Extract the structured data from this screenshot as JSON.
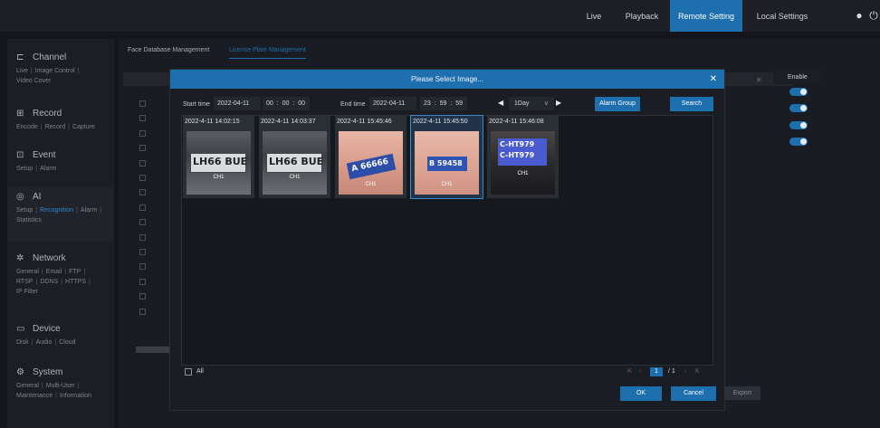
{
  "topnav": {
    "live": "Live",
    "playback": "Playback",
    "remote_setting": "Remote Setting",
    "local_settings": "Local Settings"
  },
  "sidebar": {
    "channel": {
      "title": "Channel",
      "links1": [
        "Live",
        "Image Control"
      ],
      "links2": [
        "Video Cover"
      ]
    },
    "record": {
      "title": "Record",
      "links1": [
        "Encode",
        "Record",
        "Capture"
      ]
    },
    "event": {
      "title": "Event",
      "links1": [
        "Setup",
        "Alarm"
      ]
    },
    "ai": {
      "title": "AI",
      "links1": [
        "Setup",
        "Recognition",
        "Alarm"
      ],
      "links2": [
        "Statistics"
      ]
    },
    "network": {
      "title": "Network",
      "links1": [
        "General",
        "Email",
        "FTP"
      ],
      "links2": [
        "RTSP",
        "DDNS",
        "HTTPS"
      ],
      "links3": [
        "IP Filter"
      ]
    },
    "device": {
      "title": "Device",
      "links1": [
        "Disk",
        "Audio",
        "Cloud"
      ]
    },
    "system": {
      "title": "System",
      "links1": [
        "General",
        "Multi-User"
      ],
      "links2": [
        "Maintenance",
        "Information"
      ]
    }
  },
  "tabs": {
    "face_db": "Face Database Management",
    "plate": "License Plate Management"
  },
  "table": {
    "enable_header": "Enable",
    "export": "Export"
  },
  "dialog": {
    "title": "Please Select Image...",
    "start_label": "Start time",
    "start_date": "2022-04-11",
    "start_time": "00 : 00 : 00",
    "end_label": "End time",
    "end_date": "2022-04-11",
    "end_time": "23 : 59 : 59",
    "range": "1Day",
    "alarm_group": "Alarm Group",
    "search": "Search",
    "all": "All",
    "page_current": "1",
    "page_total": "/ 1",
    "ok": "OK",
    "cancel": "Cancel",
    "images": [
      {
        "time": "2022-4-11 14:02:15",
        "plate": "LH66 BUE",
        "channel": "CH1"
      },
      {
        "time": "2022-4-11 14:03:37",
        "plate": "LH66 BUE",
        "channel": "CH1"
      },
      {
        "time": "2022-4-11 15:45:46",
        "plate": "A 66666",
        "channel": "CH1"
      },
      {
        "time": "2022-4-11 15:45:50",
        "plate": "B 59458",
        "channel": "CH1"
      },
      {
        "time": "2022-4-11 15:46:08",
        "plate": "C-HT979",
        "plate2": "C-HT979",
        "channel": "CH1"
      }
    ]
  },
  "colors": {
    "accent": "#1d6fae",
    "background": "#14161b"
  }
}
